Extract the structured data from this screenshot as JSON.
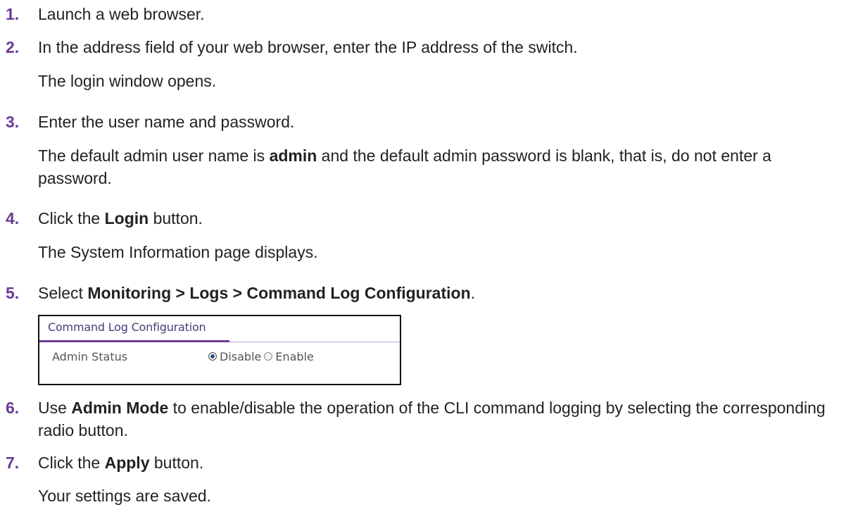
{
  "steps": [
    {
      "num": "1.",
      "text": "Launch a web browser."
    },
    {
      "num": "2.",
      "text": "In the address field of your web browser, enter the IP address of the switch.",
      "note": "The login window opens."
    },
    {
      "num": "3.",
      "text": "Enter the user name and password.",
      "note_pre": "The default admin user name is ",
      "note_bold": "admin",
      "note_post": " and the default admin password is blank, that is, do not enter a password."
    },
    {
      "num": "4.",
      "text_pre": "Click the ",
      "text_bold": "Login",
      "text_post": " button.",
      "note": "The System Information page displays."
    },
    {
      "num": "5.",
      "text_pre": "Select ",
      "text_bold": "Monitoring > Logs > Command Log Configuration",
      "text_post": "."
    },
    {
      "num": "6.",
      "text_pre": "Use ",
      "text_bold": "Admin Mode",
      "text_post": " to enable/disable the operation of the CLI command logging by selecting the corresponding radio button."
    },
    {
      "num": "7.",
      "text_pre": "Click the ",
      "text_bold": "Apply",
      "text_post": " button.",
      "note": "Your settings are saved."
    }
  ],
  "panel": {
    "title": "Command Log Configuration",
    "field_label": "Admin Status",
    "options": [
      {
        "label": "Disable",
        "checked": true
      },
      {
        "label": "Enable",
        "checked": false
      }
    ]
  }
}
